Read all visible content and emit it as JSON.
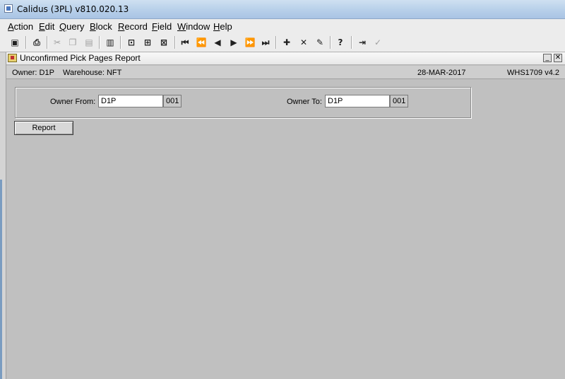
{
  "window": {
    "title": "Calidus (3PL) v810.020.13"
  },
  "menu": [
    {
      "label": "Action",
      "u": "A",
      "rest": "ction"
    },
    {
      "label": "Edit",
      "u": "E",
      "rest": "dit"
    },
    {
      "label": "Query",
      "u": "Q",
      "rest": "uery"
    },
    {
      "label": "Block",
      "u": "B",
      "rest": "lock"
    },
    {
      "label": "Record",
      "u": "R",
      "rest": "ecord"
    },
    {
      "label": "Field",
      "u": "F",
      "rest": "ield"
    },
    {
      "label": "Window",
      "u": "W",
      "rest": "indow"
    },
    {
      "label": "Help",
      "u": "H",
      "rest": "elp"
    }
  ],
  "toolbar": {
    "icons": [
      "save-icon",
      "print-icon",
      "cut-icon",
      "copy-icon",
      "paste-icon",
      "clear-field-icon",
      "enter-query-icon",
      "execute-query-icon",
      "cancel-query-icon",
      "first-record-icon",
      "previous-block-icon",
      "previous-record-icon",
      "next-record-icon",
      "next-block-icon",
      "last-record-icon",
      "insert-record-icon",
      "delete-record-icon",
      "duplicate-record-icon",
      "help-icon",
      "exit-icon",
      "commit-icon"
    ]
  },
  "form": {
    "title": "Unconfirmed Pick Pages Report",
    "owner_text": "Owner: D1P",
    "warehouse_text": "Warehouse: NFT",
    "date": "28-MAR-2017",
    "version": "WHS1709  v4.2",
    "owner_from_label": "Owner From:",
    "owner_from_value": "D1P",
    "owner_from_code": "001",
    "owner_to_label": "Owner To:",
    "owner_to_value": "D1P",
    "owner_to_code": "001",
    "report_button": "Report"
  }
}
